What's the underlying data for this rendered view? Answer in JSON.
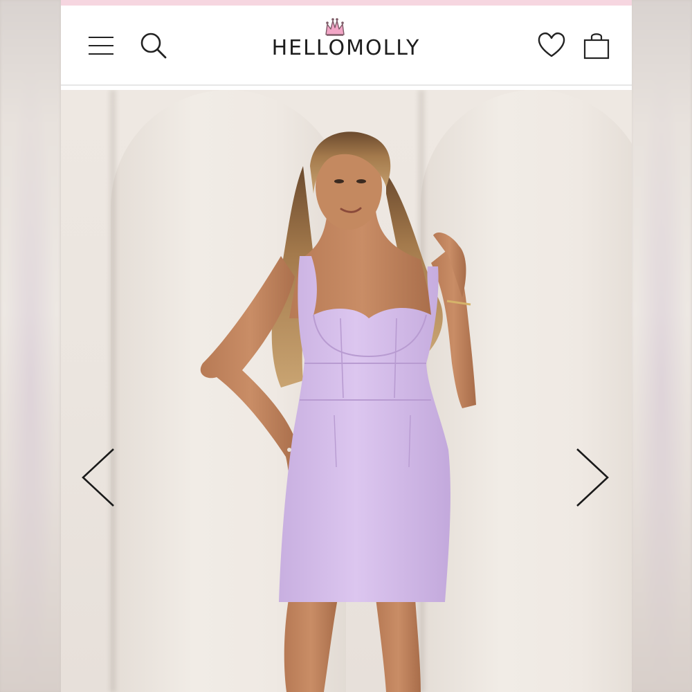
{
  "brand": {
    "name": "HELLOMOLLY",
    "accent_color": "#f6d6e0",
    "crown_color": "#f2a6c6"
  },
  "header": {
    "menu_icon": "hamburger-menu-icon",
    "search_icon": "search-icon",
    "wishlist_icon": "heart-icon",
    "bag_icon": "shopping-bag-icon"
  },
  "gallery": {
    "product_color": "#d7bfe9",
    "prev_icon": "chevron-left-icon",
    "next_icon": "chevron-right-icon"
  }
}
